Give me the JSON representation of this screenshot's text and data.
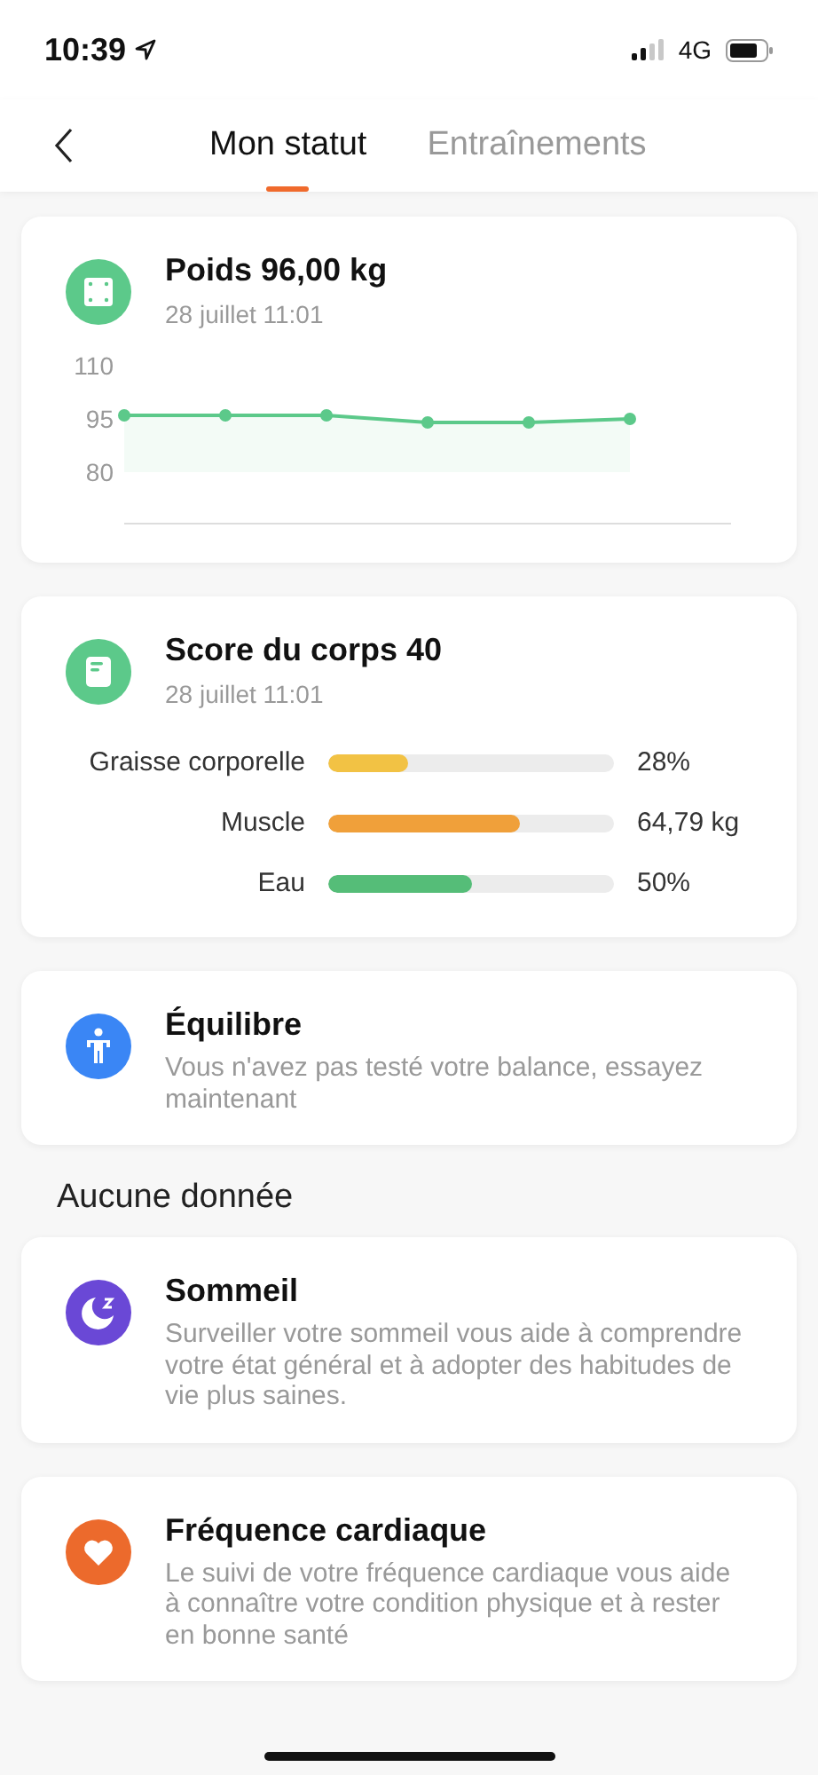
{
  "status_bar": {
    "time": "10:39",
    "network": "4G"
  },
  "tabs": [
    {
      "label": "Mon statut",
      "selected": true
    },
    {
      "label": "Entraînements",
      "selected": false
    }
  ],
  "weight_card": {
    "title": "Poids 96,00 kg",
    "date": "28 juillet 11:01",
    "color": "#5cc98a",
    "chart_data": {
      "type": "line",
      "categories": [
        null,
        null,
        null,
        null,
        null,
        null
      ],
      "series": [
        {
          "marker": "circle",
          "color": "#5cc98a",
          "values": [
            96,
            96,
            96,
            94,
            94,
            95
          ]
        }
      ],
      "ylim": [
        80,
        110
      ],
      "yticks": [
        {
          "value": 80,
          "label": "80"
        },
        {
          "value": 95,
          "label": "95"
        },
        {
          "value": 110,
          "label": "110"
        }
      ]
    }
  },
  "body_card": {
    "title": "Score du corps 40",
    "date": "28 juillet 11:01",
    "color": "#5cc98a",
    "metrics": [
      {
        "label": "Graisse corporelle",
        "level": 0.28,
        "value": "28%",
        "color": "#f2c244"
      },
      {
        "label": "Muscle",
        "level": 0.67,
        "value": "64,79 kg",
        "color": "#f0a03a"
      },
      {
        "label": "Eau",
        "level": 0.5,
        "value": "50%",
        "color": "#55bd78"
      }
    ]
  },
  "balance_card": {
    "kind": "balance",
    "title": "Équilibre",
    "text": "Vous n'avez pas testé votre balance, essayez maintenant",
    "color": "#3a86f5"
  },
  "section_title": "Aucune donnée",
  "empty_cards": [
    {
      "kind": "sleep",
      "title": "Sommeil",
      "text": "Surveiller votre sommeil vous aide à comprendre votre état général et à adopter des habitudes de vie plus saines.",
      "color": "#6a48d6"
    },
    {
      "kind": "heart",
      "title": "Fréquence cardiaque",
      "text": "Le suivi de votre fréquence cardiaque vous aide à connaître votre condition physique et à rester en bonne santé",
      "color": "#ec6a2c"
    }
  ]
}
